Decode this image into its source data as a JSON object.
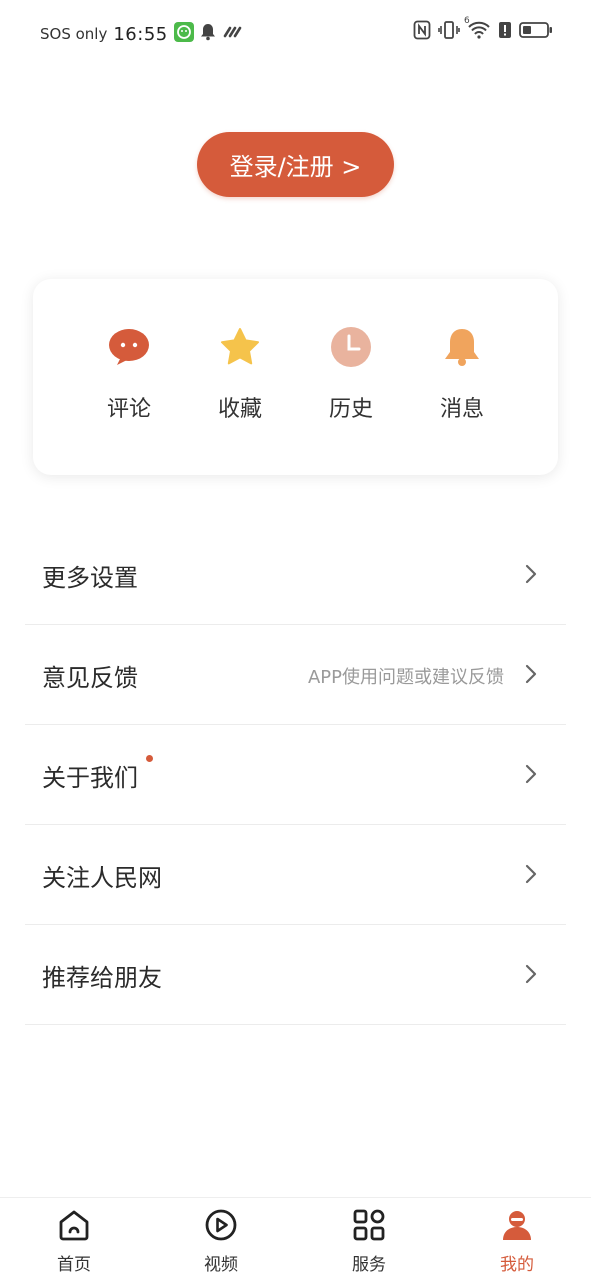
{
  "status_bar": {
    "carrier": "SOS only",
    "time": "16:55",
    "icons": [
      "wechat-icon",
      "bell-icon",
      "link-icon",
      "nfc-icon",
      "vibrate-icon",
      "wifi-icon",
      "alert-icon",
      "battery-icon"
    ],
    "wifi_badge": "6"
  },
  "login": {
    "label": "登录/注册 >"
  },
  "quick_actions": [
    {
      "label": "评论",
      "icon": "comment-icon",
      "color": "#d55b3b"
    },
    {
      "label": "收藏",
      "icon": "star-icon",
      "color": "#f5c34b"
    },
    {
      "label": "历史",
      "icon": "clock-icon",
      "color": "#e9b39e"
    },
    {
      "label": "消息",
      "icon": "bell-icon",
      "color": "#f0a45d"
    }
  ],
  "menu": [
    {
      "title": "更多设置",
      "hint": ""
    },
    {
      "title": "意见反馈",
      "hint": "APP使用问题或建议反馈"
    },
    {
      "title": "关于我们",
      "hint": "",
      "badge": true
    },
    {
      "title": "关注人民网",
      "hint": ""
    },
    {
      "title": "推荐给朋友",
      "hint": ""
    }
  ],
  "tabs": [
    {
      "label": "首页",
      "icon": "home-icon"
    },
    {
      "label": "视频",
      "icon": "play-icon"
    },
    {
      "label": "服务",
      "icon": "grid-icon"
    },
    {
      "label": "我的",
      "icon": "user-icon",
      "active": true
    }
  ],
  "colors": {
    "accent": "#d55b3b",
    "text": "#2b2b2b",
    "hint": "#9a9a9a"
  }
}
